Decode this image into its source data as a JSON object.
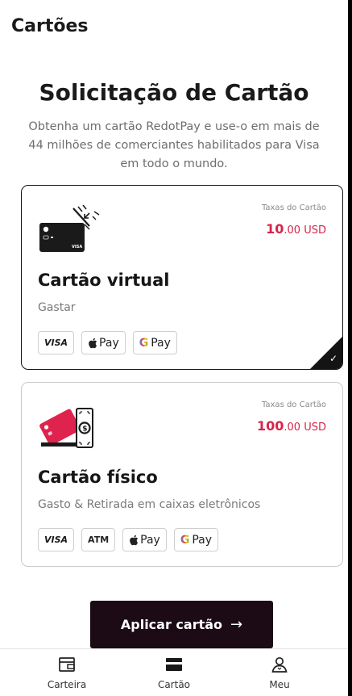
{
  "header": {
    "title": "Cartões"
  },
  "intro": {
    "heading": "Solicitação de Cartão",
    "subtitle": "Obtenha um cartão RedotPay e use-o em mais de 44 milhões de comerciantes habilitados para Visa em todo o mundo."
  },
  "cards": [
    {
      "title": "Cartão virtual",
      "description": "Gastar",
      "fee_label": "Taxas do Cartão",
      "fee_amount": "10",
      "fee_decimals": ".00 USD",
      "badges": [
        "VISA",
        "Pay",
        "Pay"
      ],
      "selected": true
    },
    {
      "title": "Cartão físico",
      "description": "Gasto & Retirada em caixas eletrônicos",
      "fee_label": "Taxas do Cartão",
      "fee_amount": "100",
      "fee_decimals": ".00 USD",
      "badges": [
        "VISA",
        "ATM",
        "Pay",
        "Pay"
      ],
      "selected": false
    }
  ],
  "apply_button": {
    "label": "Aplicar cartão",
    "icon": "arrow-right-icon"
  },
  "bottom_nav": [
    {
      "label": "Carteira",
      "icon": "wallet-icon"
    },
    {
      "label": "Cartão",
      "icon": "card-icon",
      "active": true
    },
    {
      "label": "Meu",
      "icon": "user-icon"
    }
  ],
  "colors": {
    "accent": "#d8234a",
    "button": "#1c0b14",
    "text": "#161616",
    "muted": "#7a7a7a"
  }
}
